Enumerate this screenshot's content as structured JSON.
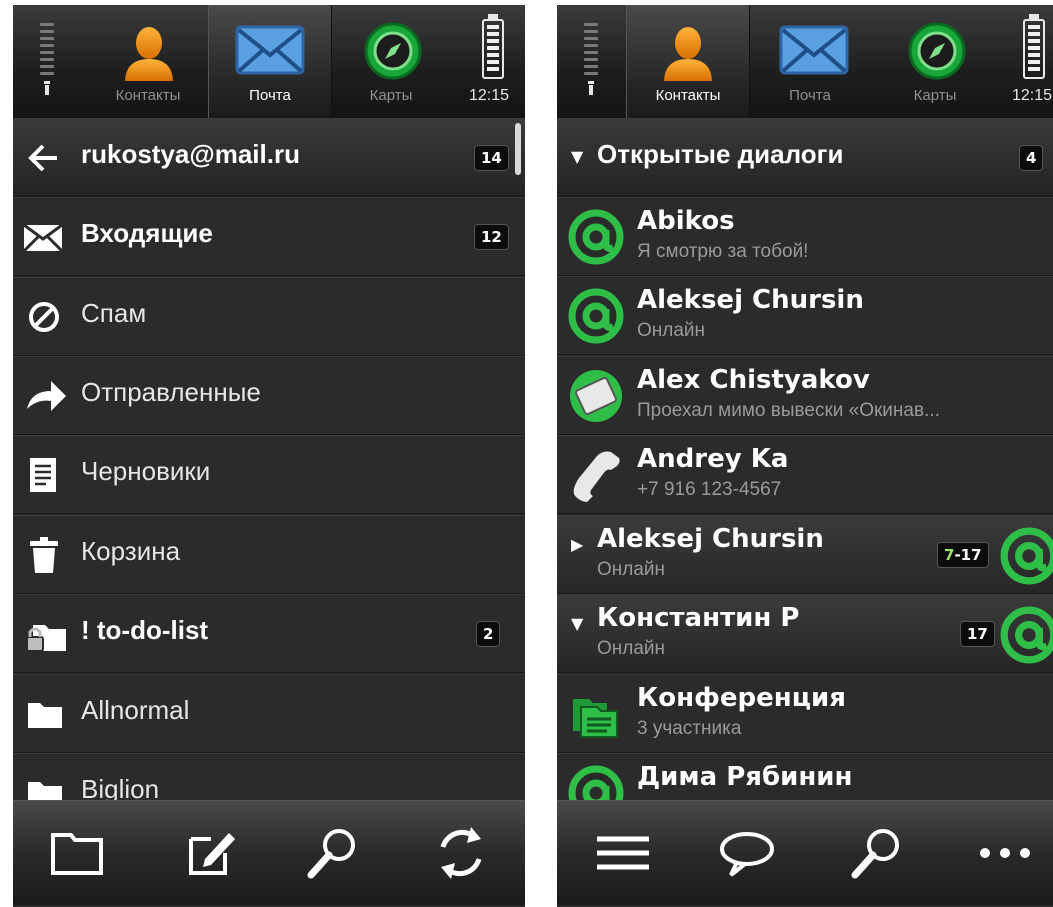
{
  "left_screen": {
    "status": {
      "clock": "12:15"
    },
    "tabs": [
      {
        "label": "Контакты",
        "icon": "person-icon"
      },
      {
        "label": "Почта",
        "icon": "envelope-icon",
        "active": true
      },
      {
        "label": "Карты",
        "icon": "compass-icon"
      }
    ],
    "header": {
      "back_icon": "arrow-left-icon",
      "title": "rukostya@mail.ru",
      "count": "14"
    },
    "folders": [
      {
        "label": "Входящие",
        "icon": "envelope-icon",
        "bold": true,
        "count": "12"
      },
      {
        "label": "Спам",
        "icon": "no-entry-icon"
      },
      {
        "label": "Отправленные",
        "icon": "arrow-right-icon"
      },
      {
        "label": "Черновики",
        "icon": "document-icon"
      },
      {
        "label": "Корзина",
        "icon": "trash-icon"
      },
      {
        "label": "! to-do-list",
        "icon": "locked-folder-icon",
        "bold": true,
        "count": "2"
      },
      {
        "label": "Allnormal",
        "icon": "folder-icon"
      },
      {
        "label": "Biglion",
        "icon": "folder-icon"
      }
    ],
    "toolbar": [
      "folder-icon",
      "compose-icon",
      "search-icon",
      "refresh-icon"
    ]
  },
  "right_screen": {
    "status": {
      "clock": "12:15"
    },
    "tabs": [
      {
        "label": "Контакты",
        "icon": "person-icon",
        "active": true
      },
      {
        "label": "Почта",
        "icon": "envelope-icon"
      },
      {
        "label": "Карты",
        "icon": "compass-icon"
      }
    ],
    "header": {
      "title": "Открытые диалоги",
      "count": "4"
    },
    "contacts": [
      {
        "name": "Abikos",
        "status": "Я смотрю за тобой!",
        "icon": "at-sign-icon"
      },
      {
        "name": "Aleksej Chursin",
        "status": "Онлайн",
        "icon": "at-sign-icon"
      },
      {
        "name": "Alex Chistyakov",
        "status": "Проехал мимо вывески «Окинав...",
        "icon": "photo-icon"
      },
      {
        "name": "Andrey Ka",
        "status": "+7 916 123-4567",
        "icon": "phone-icon"
      }
    ],
    "groups": [
      {
        "name": "Aleksej Chursin",
        "status": "Онлайн",
        "count_a": "7",
        "count_b": "-17",
        "expanded": false
      },
      {
        "name": "Константин Р",
        "status": "Онлайн",
        "count": "17",
        "expanded": true
      }
    ],
    "more_contacts": [
      {
        "name": "Конференция",
        "status": "3 участника",
        "icon": "conference-icon"
      },
      {
        "name": "Дима Рябинин",
        "status": "",
        "icon": "at-sign-icon"
      }
    ],
    "toolbar": [
      "menu-icon",
      "chat-icon",
      "search-icon",
      "more-icon"
    ]
  },
  "colors": {
    "accent_green": "#2fae3a",
    "background": "#2b2b2b",
    "envelope_blue": "#4a8fd0"
  }
}
